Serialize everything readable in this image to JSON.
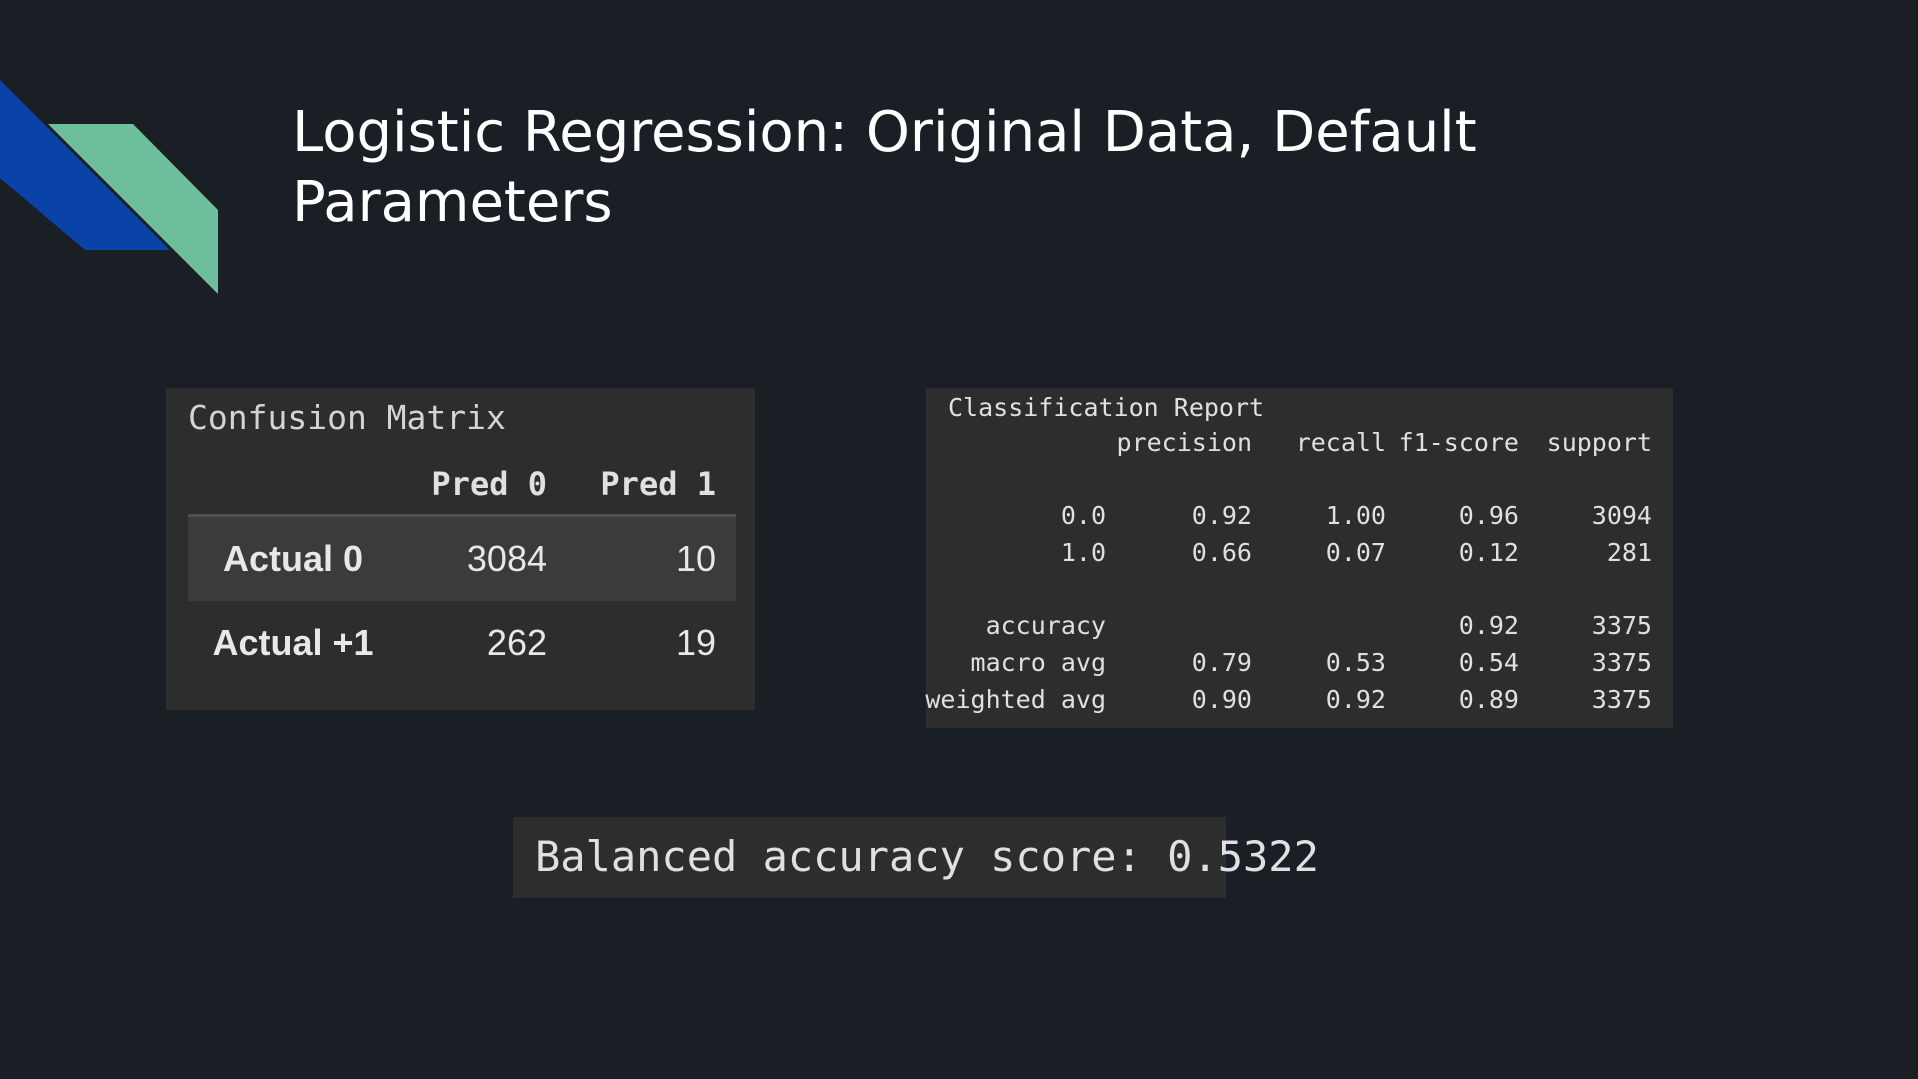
{
  "slide": {
    "title": "Logistic Regression: Original Data, Default Parameters",
    "accent_colors": {
      "blue": "#0a43a8",
      "green": "#6ebf9b",
      "background": "#1a1e25",
      "panel": "#2d2d2d"
    }
  },
  "confusion_matrix": {
    "heading": "Confusion Matrix",
    "columns": [
      "Pred 0",
      "Pred 1"
    ],
    "rows": [
      {
        "label": "Actual 0",
        "values": [
          "3084",
          "10"
        ]
      },
      {
        "label": "Actual +1",
        "values": [
          "262",
          "19"
        ]
      }
    ]
  },
  "classification_report": {
    "heading": "Classification Report",
    "columns": [
      "precision",
      "recall",
      "f1-score",
      "support"
    ],
    "class_rows": [
      {
        "label": "0.0",
        "precision": "0.92",
        "recall": "1.00",
        "f1": "0.96",
        "support": "3094"
      },
      {
        "label": "1.0",
        "precision": "0.66",
        "recall": "0.07",
        "f1": "0.12",
        "support": "281"
      }
    ],
    "accuracy_row": {
      "label": "accuracy",
      "f1": "0.92",
      "support": "3375"
    },
    "avg_rows": [
      {
        "label": "macro avg",
        "precision": "0.79",
        "recall": "0.53",
        "f1": "0.54",
        "support": "3375"
      },
      {
        "label": "weighted avg",
        "precision": "0.90",
        "recall": "0.92",
        "f1": "0.89",
        "support": "3375"
      }
    ]
  },
  "balanced_accuracy": {
    "text": "Balanced accuracy score: 0.5322"
  }
}
